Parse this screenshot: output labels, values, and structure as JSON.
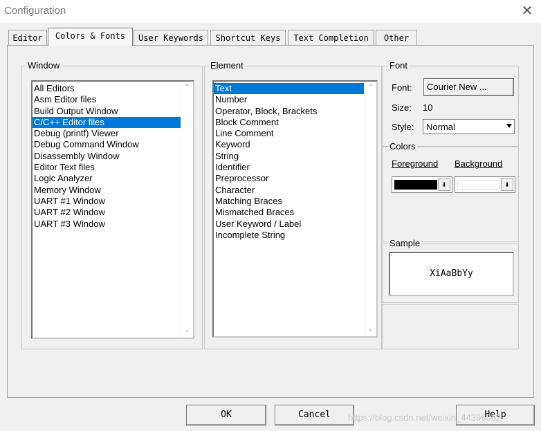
{
  "window": {
    "title": "Configuration",
    "close_glyph": "✕"
  },
  "tabs": [
    {
      "label": "Editor"
    },
    {
      "label": "Colors & Fonts"
    },
    {
      "label": "User Keywords"
    },
    {
      "label": "Shortcut Keys"
    },
    {
      "label": "Text Completion"
    },
    {
      "label": "Other"
    }
  ],
  "window_group": {
    "label": "Window",
    "items": [
      "All Editors",
      "Asm Editor files",
      "Build Output Window",
      "C/C++ Editor files",
      "Debug (printf) Viewer",
      "Debug Command Window",
      "Disassembly Window",
      "Editor Text files",
      "Logic Analyzer",
      "Memory Window",
      "UART #1 Window",
      "UART #2 Window",
      "UART #3 Window"
    ],
    "selected": "C/C++ Editor files"
  },
  "element_group": {
    "label": "Element",
    "items": [
      "Text",
      "Number",
      "Operator, Block, Brackets",
      "Block Comment",
      "Line Comment",
      "Keyword",
      "String",
      "Identifier",
      "Preprocessor",
      "Character",
      "Matching Braces",
      "Mismatched Braces",
      "User Keyword / Label",
      "Incomplete String"
    ],
    "selected": "Text"
  },
  "font_group": {
    "label": "Font",
    "font_label": "Font:",
    "font_button": "Courier New ...",
    "size_label": "Size:",
    "size_value": "10",
    "style_label": "Style:",
    "style_value": "Normal"
  },
  "colors_group": {
    "label": "Colors",
    "foreground_label": "Foreground",
    "background_label": "Background",
    "foreground_color": "#000000",
    "background_color": "#ffffff",
    "dropdown_glyph": "⬇"
  },
  "sample_group": {
    "label": "Sample",
    "text": "XiAaBbYy"
  },
  "footer": {
    "ok": "OK",
    "cancel": "Cancel",
    "help": "Help"
  },
  "watermark": "https://blog.csdn.net/weixin_44396062",
  "colors": {
    "selection": "#0078d7"
  }
}
